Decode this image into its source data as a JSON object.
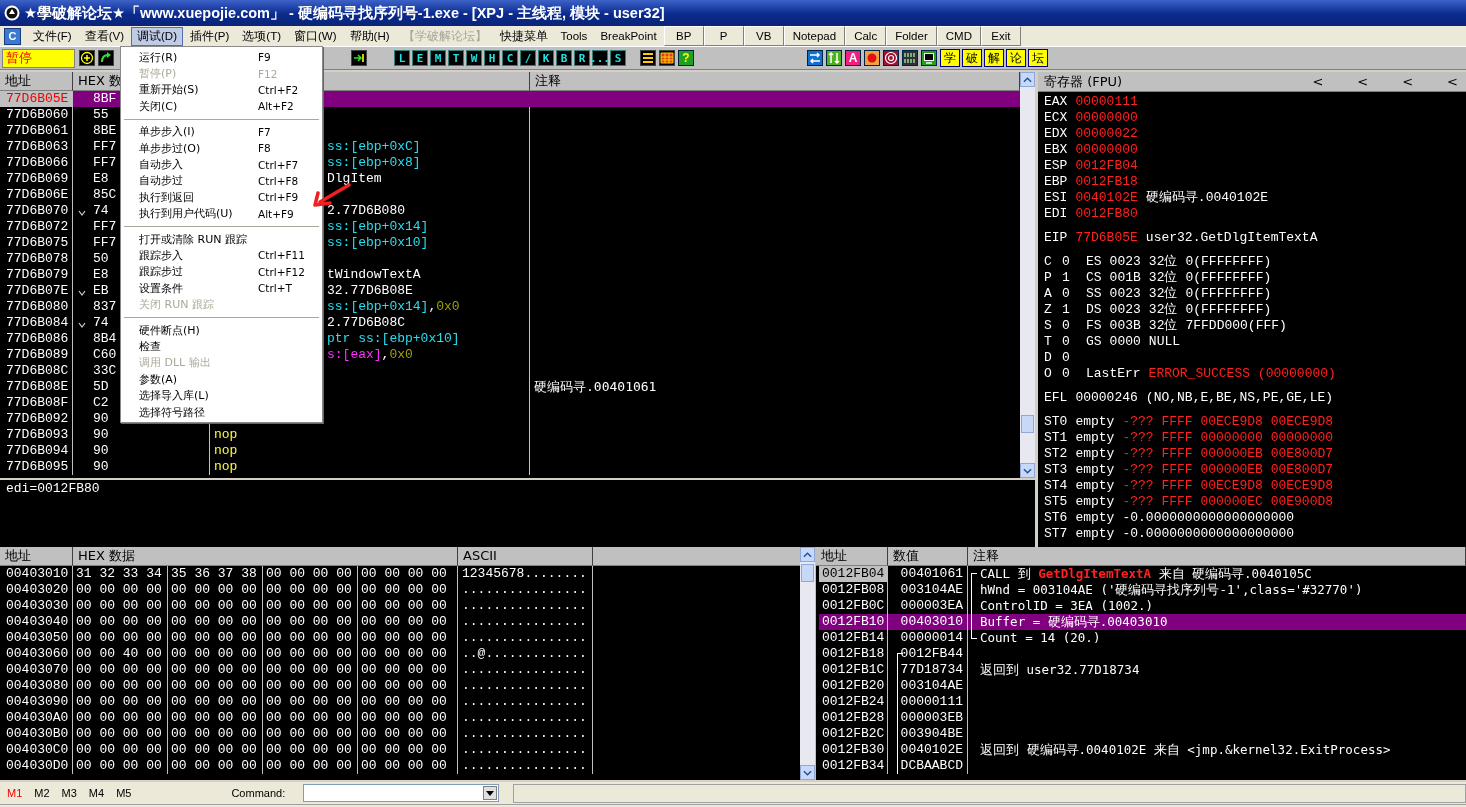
{
  "window": {
    "title": "★學破解论坛★「www.xuepojie.com」 - 硬编码寻找序列号-1.exe - [XPJ - 主线程, 模块 - user32]"
  },
  "menu_badge": "C",
  "menu": [
    {
      "label": "文件(F)",
      "selected": false,
      "disabled": false
    },
    {
      "label": "查看(V)",
      "selected": false,
      "disabled": false
    },
    {
      "label": "调试(D)",
      "selected": true,
      "disabled": false
    },
    {
      "label": "插件(P)",
      "selected": false,
      "disabled": false
    },
    {
      "label": "选项(T)",
      "selected": false,
      "disabled": false
    },
    {
      "label": "窗口(W)",
      "selected": false,
      "disabled": false
    },
    {
      "label": "帮助(H)",
      "selected": false,
      "disabled": false
    },
    {
      "label": "【学破解论坛】",
      "selected": false,
      "disabled": true
    },
    {
      "label": "快捷菜单",
      "selected": false,
      "disabled": false
    },
    {
      "label": "Tools",
      "selected": false,
      "disabled": false
    },
    {
      "label": "BreakPoint",
      "selected": false,
      "disabled": false
    }
  ],
  "menu_buttons": [
    "BP",
    "P",
    "VB",
    "Notepad",
    "Calc",
    "Folder",
    "CMD",
    "Exit"
  ],
  "toolbar": {
    "status": "暂停",
    "letters": [
      "L",
      "E",
      "M",
      "T",
      "W",
      "H",
      "C",
      "/",
      "K",
      "B",
      "R",
      "...",
      "S"
    ],
    "help": "?",
    "font_button": "A",
    "forum_buttons": [
      "学",
      "破",
      "解",
      "论",
      "坛"
    ]
  },
  "debug_menu": [
    {
      "kind": "item",
      "label": "运行(R)",
      "shortcut": "F9",
      "disabled": false
    },
    {
      "kind": "item",
      "label": "暂停(P)",
      "shortcut": "F12",
      "disabled": true
    },
    {
      "kind": "item",
      "label": "重新开始(S)",
      "shortcut": "Ctrl+F2",
      "disabled": false
    },
    {
      "kind": "item",
      "label": "关闭(C)",
      "shortcut": "Alt+F2",
      "disabled": false
    },
    {
      "kind": "separator"
    },
    {
      "kind": "item",
      "label": "单步步入(I)",
      "shortcut": "F7",
      "disabled": false
    },
    {
      "kind": "item",
      "label": "单步步过(O)",
      "shortcut": "F8",
      "disabled": false
    },
    {
      "kind": "item",
      "label": "自动步入",
      "shortcut": "Ctrl+F7",
      "disabled": false
    },
    {
      "kind": "item",
      "label": "自动步过",
      "shortcut": "Ctrl+F8",
      "disabled": false
    },
    {
      "kind": "item",
      "label": "执行到返回",
      "shortcut": "Ctrl+F9",
      "disabled": false
    },
    {
      "kind": "item",
      "label": "执行到用户代码(U)",
      "shortcut": "Alt+F9",
      "disabled": false
    },
    {
      "kind": "separator"
    },
    {
      "kind": "item",
      "label": "打开或清除 RUN 跟踪",
      "disabled": false
    },
    {
      "kind": "item",
      "label": "跟踪步入",
      "shortcut": "Ctrl+F11",
      "disabled": false
    },
    {
      "kind": "item",
      "label": "跟踪步过",
      "shortcut": "Ctrl+F12",
      "disabled": false
    },
    {
      "kind": "item",
      "label": "设置条件",
      "shortcut": "Ctrl+T",
      "disabled": false
    },
    {
      "kind": "item",
      "label": "关闭 RUN 跟踪",
      "disabled": true
    },
    {
      "kind": "separator"
    },
    {
      "kind": "item",
      "label": "硬件断点(H)",
      "disabled": false
    },
    {
      "kind": "item",
      "label": "检查",
      "disabled": false
    },
    {
      "kind": "item",
      "label": "调用 DLL 输出",
      "disabled": true
    },
    {
      "kind": "item",
      "label": "参数(A)",
      "disabled": false
    },
    {
      "kind": "item",
      "label": "选择导入库(L)",
      "disabled": false
    },
    {
      "kind": "item",
      "label": "选择符号路径",
      "disabled": false
    }
  ],
  "disasm": {
    "headers": {
      "address": "地址",
      "hex": "HEX 数",
      "comment": "注释"
    },
    "rows": [
      {
        "address": "77D6B05E",
        "hex": "8BF",
        "jump": false,
        "selected": true
      },
      {
        "address": "77D6B060",
        "hex": "55",
        "jump": false,
        "selected": false
      },
      {
        "address": "77D6B061",
        "hex": "8BE",
        "jump": false,
        "selected": false
      },
      {
        "address": "77D6B063",
        "hex": "FF7",
        "jump": false,
        "selected": false,
        "code": [
          {
            "text": "ss:[ebp+0xC]",
            "kind": "mem"
          }
        ]
      },
      {
        "address": "77D6B066",
        "hex": "FF7",
        "jump": false,
        "selected": false,
        "code": [
          {
            "text": "ss:[ebp+0x8]",
            "kind": "mem"
          }
        ]
      },
      {
        "address": "77D6B069",
        "hex": "E8",
        "jump": false,
        "selected": false,
        "code": [
          {
            "text": "DlgItem",
            "kind": "plain"
          }
        ]
      },
      {
        "address": "77D6B06E",
        "hex": "85C",
        "jump": false,
        "selected": false
      },
      {
        "address": "77D6B070",
        "hex": "74",
        "jump": true,
        "selected": false,
        "code": [
          {
            "text": "2.77D6B080",
            "kind": "plain"
          }
        ]
      },
      {
        "address": "77D6B072",
        "hex": "FF7",
        "jump": false,
        "selected": false,
        "code": [
          {
            "text": "ss:[ebp+0x14]",
            "kind": "mem"
          }
        ]
      },
      {
        "address": "77D6B075",
        "hex": "FF7",
        "jump": false,
        "selected": false,
        "code": [
          {
            "text": "ss:[ebp+0x10]",
            "kind": "mem"
          }
        ]
      },
      {
        "address": "77D6B078",
        "hex": "50",
        "jump": false,
        "selected": false
      },
      {
        "address": "77D6B079",
        "hex": "E8",
        "jump": false,
        "selected": false,
        "code": [
          {
            "text": "tWindowTextA",
            "kind": "plain"
          }
        ]
      },
      {
        "address": "77D6B07E",
        "hex": "EB",
        "jump": true,
        "selected": false,
        "code": [
          {
            "text": "32.77D6B08E",
            "kind": "plain"
          }
        ]
      },
      {
        "address": "77D6B080",
        "hex": "837",
        "jump": false,
        "selected": false,
        "code": [
          {
            "text": "ss:[ebp+0x14]",
            "kind": "mem"
          },
          {
            "text": ",",
            "kind": "plain"
          },
          {
            "text": "0x0",
            "kind": "const"
          }
        ]
      },
      {
        "address": "77D6B084",
        "hex": "74",
        "jump": true,
        "selected": false,
        "code": [
          {
            "text": "2.77D6B08C",
            "kind": "plain"
          }
        ]
      },
      {
        "address": "77D6B086",
        "hex": "8B4",
        "jump": false,
        "selected": false,
        "code": [
          {
            "text": "ptr ss:[ebp+0x10]",
            "kind": "mem"
          }
        ]
      },
      {
        "address": "77D6B089",
        "hex": "C60",
        "jump": false,
        "selected": false,
        "code": [
          {
            "text": "s:[eax]",
            "kind": "seg"
          },
          {
            "text": ",",
            "kind": "plain"
          },
          {
            "text": "0x0",
            "kind": "const"
          }
        ]
      },
      {
        "address": "77D6B08C",
        "hex": "33C",
        "jump": false,
        "selected": false
      },
      {
        "address": "77D6B08E",
        "hex": "5D",
        "jump": false,
        "selected": false,
        "comment": "硬编码寻.00401061"
      },
      {
        "address": "77D6B08F",
        "hex": "C2",
        "jump": false,
        "selected": false
      },
      {
        "address": "77D6B092",
        "hex": "90",
        "jump": false,
        "selected": false
      },
      {
        "address": "77D6B093",
        "hex": "90",
        "jump": false,
        "selected": false,
        "code": [
          {
            "text": "nop",
            "kind": "nop"
          }
        ]
      },
      {
        "address": "77D6B094",
        "hex": "90",
        "jump": false,
        "selected": false,
        "code": [
          {
            "text": "nop",
            "kind": "nop"
          }
        ]
      },
      {
        "address": "77D6B095",
        "hex": "90",
        "jump": false,
        "selected": false,
        "code": [
          {
            "text": "nop",
            "kind": "nop"
          }
        ]
      }
    ]
  },
  "info": "edi=0012FB80",
  "registers": {
    "title": "寄存器 (FPU)",
    "nav": [
      "<",
      "<",
      "<",
      "<"
    ],
    "general": [
      {
        "name": "EAX",
        "value": "00000111"
      },
      {
        "name": "ECX",
        "value": "00000000"
      },
      {
        "name": "EDX",
        "value": "00000022"
      },
      {
        "name": "EBX",
        "value": "00000000"
      },
      {
        "name": "ESP",
        "value": "0012FB04"
      },
      {
        "name": "EBP",
        "value": "0012FB18"
      },
      {
        "name": "ESI",
        "value": "0040102E",
        "comment": "硬编码寻.0040102E"
      },
      {
        "name": "EDI",
        "value": "0012FB80"
      }
    ],
    "eip": {
      "name": "EIP",
      "value": "77D6B05E",
      "comment": "user32.GetDlgItemTextA"
    },
    "flags": [
      {
        "flag": "C",
        "bit": "0",
        "segment": "ES",
        "selector": "0023",
        "width": "32位",
        "base": "0(FFFFFFFF)"
      },
      {
        "flag": "P",
        "bit": "1",
        "segment": "CS",
        "selector": "001B",
        "width": "32位",
        "base": "0(FFFFFFFF)"
      },
      {
        "flag": "A",
        "bit": "0",
        "segment": "SS",
        "selector": "0023",
        "width": "32位",
        "base": "0(FFFFFFFF)"
      },
      {
        "flag": "Z",
        "bit": "1",
        "segment": "DS",
        "selector": "0023",
        "width": "32位",
        "base": "0(FFFFFFFF)"
      },
      {
        "flag": "S",
        "bit": "0",
        "segment": "FS",
        "selector": "003B",
        "width": "32位",
        "base": "7FFDD000(FFF)"
      },
      {
        "flag": "T",
        "bit": "0",
        "segment": "GS",
        "selector": "0000",
        "base": "NULL"
      },
      {
        "flag": "D",
        "bit": "0"
      },
      {
        "flag": "O",
        "bit": "0",
        "label": "LastErr",
        "error": "ERROR_SUCCESS (00000000)"
      }
    ],
    "efl": {
      "name": "EFL",
      "value": "00000246",
      "decoded": "(NO,NB,E,BE,NS,PE,GE,LE)"
    },
    "fpu": [
      {
        "name": "ST0",
        "tag": "empty",
        "kind": "invalid",
        "value": "-??? FFFF 00ECE9D8 00ECE9D8"
      },
      {
        "name": "ST1",
        "tag": "empty",
        "kind": "invalid",
        "value": "-??? FFFF 00000000 00000000"
      },
      {
        "name": "ST2",
        "tag": "empty",
        "kind": "invalid",
        "value": "-??? FFFF 000000EB 00E800D7"
      },
      {
        "name": "ST3",
        "tag": "empty",
        "kind": "invalid",
        "value": "-??? FFFF 000000EB 00E800D7"
      },
      {
        "name": "ST4",
        "tag": "empty",
        "kind": "invalid",
        "value": "-??? FFFF 00ECE9D8 00ECE9D8"
      },
      {
        "name": "ST5",
        "tag": "empty",
        "kind": "invalid",
        "value": "-??? FFFF 000000EC 00E900D8"
      },
      {
        "name": "ST6",
        "tag": "empty",
        "kind": "number",
        "value": "-0.0000000000000000000"
      },
      {
        "name": "ST7",
        "tag": "empty",
        "kind": "number",
        "value": "-0.0000000000000000000"
      }
    ]
  },
  "dump": {
    "headers": {
      "address": "地址",
      "hex": "HEX 数据",
      "ascii": "ASCII"
    },
    "rows": [
      {
        "address": "00403010",
        "hex": [
          "31 32 33 34",
          "35 36 37 38",
          "00 00 00 00",
          "00 00 00 00"
        ],
        "ascii": "12345678........"
      },
      {
        "address": "00403020",
        "hex": [
          "00 00 00 00",
          "00 00 00 00",
          "00 00 00 00",
          "00 00 00 00"
        ],
        "ascii": "................"
      },
      {
        "address": "00403030",
        "hex": [
          "00 00 00 00",
          "00 00 00 00",
          "00 00 00 00",
          "00 00 00 00"
        ],
        "ascii": "................"
      },
      {
        "address": "00403040",
        "hex": [
          "00 00 00 00",
          "00 00 00 00",
          "00 00 00 00",
          "00 00 00 00"
        ],
        "ascii": "................"
      },
      {
        "address": "00403050",
        "hex": [
          "00 00 00 00",
          "00 00 00 00",
          "00 00 00 00",
          "00 00 00 00"
        ],
        "ascii": "................"
      },
      {
        "address": "00403060",
        "hex": [
          "00 00 40 00",
          "00 00 00 00",
          "00 00 00 00",
          "00 00 00 00"
        ],
        "ascii": "..@............."
      },
      {
        "address": "00403070",
        "hex": [
          "00 00 00 00",
          "00 00 00 00",
          "00 00 00 00",
          "00 00 00 00"
        ],
        "ascii": "................"
      },
      {
        "address": "00403080",
        "hex": [
          "00 00 00 00",
          "00 00 00 00",
          "00 00 00 00",
          "00 00 00 00"
        ],
        "ascii": "................"
      },
      {
        "address": "00403090",
        "hex": [
          "00 00 00 00",
          "00 00 00 00",
          "00 00 00 00",
          "00 00 00 00"
        ],
        "ascii": "................"
      },
      {
        "address": "004030A0",
        "hex": [
          "00 00 00 00",
          "00 00 00 00",
          "00 00 00 00",
          "00 00 00 00"
        ],
        "ascii": "................"
      },
      {
        "address": "004030B0",
        "hex": [
          "00 00 00 00",
          "00 00 00 00",
          "00 00 00 00",
          "00 00 00 00"
        ],
        "ascii": "................"
      },
      {
        "address": "004030C0",
        "hex": [
          "00 00 00 00",
          "00 00 00 00",
          "00 00 00 00",
          "00 00 00 00"
        ],
        "ascii": "................"
      },
      {
        "address": "004030D0",
        "hex": [
          "00 00 00 00",
          "00 00 00 00",
          "00 00 00 00",
          "00 00 00 00"
        ],
        "ascii": "................"
      }
    ]
  },
  "stack": {
    "headers": {
      "address": "地址",
      "value": "数值",
      "comment": "注释"
    },
    "rows": [
      {
        "address": "0012FB04",
        "value": "00401061",
        "current": true,
        "selected": false,
        "comment_bracket": true,
        "value_bracket": false,
        "comment": [
          {
            "text": "CALL 到 ",
            "kind": "plain"
          },
          {
            "text": "GetDlgItemTextA",
            "kind": "api"
          },
          {
            "text": " 来自 硬编码寻.0040105C",
            "kind": "plain"
          }
        ]
      },
      {
        "address": "0012FB08",
        "value": "003104AE",
        "current": false,
        "selected": false,
        "comment_bracket": true,
        "value_bracket": false,
        "comment": [
          {
            "text": "hWnd = 003104AE ('硬编码寻找序列号-1',class='#32770')",
            "kind": "plain"
          }
        ]
      },
      {
        "address": "0012FB0C",
        "value": "000003EA",
        "current": false,
        "selected": false,
        "comment_bracket": true,
        "value_bracket": false,
        "comment": [
          {
            "text": "ControlID = 3EA (1002.)",
            "kind": "plain"
          }
        ]
      },
      {
        "address": "0012FB10",
        "value": "00403010",
        "current": false,
        "selected": true,
        "comment_bracket": true,
        "value_bracket": false,
        "comment": [
          {
            "text": "Buffer = 硬编码寻.00403010",
            "kind": "plain"
          }
        ]
      },
      {
        "address": "0012FB14",
        "value": "00000014",
        "current": false,
        "selected": false,
        "comment_bracket": true,
        "value_bracket": false,
        "comment": [
          {
            "text": "Count = 14 (20.)",
            "kind": "plain"
          }
        ]
      },
      {
        "address": "0012FB18",
        "value": "0012FB44",
        "current": false,
        "selected": false,
        "comment_bracket": false,
        "value_bracket": true
      },
      {
        "address": "0012FB1C",
        "value": "77D18734",
        "current": false,
        "selected": false,
        "comment_bracket": false,
        "value_bracket": true,
        "comment": [
          {
            "text": "返回到 user32.77D18734",
            "kind": "plain"
          }
        ]
      },
      {
        "address": "0012FB20",
        "value": "003104AE",
        "current": false,
        "selected": false,
        "comment_bracket": false,
        "value_bracket": true
      },
      {
        "address": "0012FB24",
        "value": "00000111",
        "current": false,
        "selected": false,
        "comment_bracket": false,
        "value_bracket": true
      },
      {
        "address": "0012FB28",
        "value": "000003EB",
        "current": false,
        "selected": false,
        "comment_bracket": false,
        "value_bracket": true
      },
      {
        "address": "0012FB2C",
        "value": "003904BE",
        "current": false,
        "selected": false,
        "comment_bracket": false,
        "value_bracket": true
      },
      {
        "address": "0012FB30",
        "value": "0040102E",
        "current": false,
        "selected": false,
        "comment_bracket": false,
        "value_bracket": true,
        "comment": [
          {
            "text": "返回到 硬编码寻.0040102E 来自 <jmp.&kernel32.ExitProcess>",
            "kind": "plain"
          }
        ]
      },
      {
        "address": "0012FB34",
        "value": "DCBAABCD",
        "current": false,
        "selected": false,
        "comment_bracket": false,
        "value_bracket": true
      }
    ]
  },
  "memory_tabs": [
    {
      "label": "M1",
      "selected": true
    },
    {
      "label": "M2",
      "selected": false
    },
    {
      "label": "M3",
      "selected": false
    },
    {
      "label": "M4",
      "selected": false
    },
    {
      "label": "M5",
      "selected": false
    }
  ],
  "command": {
    "label": "Command:"
  }
}
